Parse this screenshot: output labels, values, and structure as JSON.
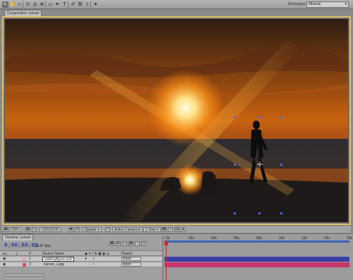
{
  "toolbar": {
    "tools": [
      {
        "icon": "selection-arrow-icon",
        "glyph": "↖",
        "active": true
      },
      {
        "icon": "hand-icon",
        "glyph": "✋",
        "active": false
      },
      {
        "icon": "zoom-icon",
        "glyph": "⌕",
        "active": false
      },
      {
        "icon": "rotate-icon",
        "glyph": "↻",
        "active": false
      },
      {
        "icon": "orbit-camera-icon",
        "glyph": "◎",
        "active": false
      },
      {
        "icon": "pan-behind-icon",
        "glyph": "⊕",
        "active": false
      },
      {
        "icon": "mask-icon",
        "glyph": "▭",
        "active": false
      },
      {
        "icon": "pen-icon",
        "glyph": "✒",
        "active": false
      },
      {
        "icon": "type-icon",
        "glyph": "T",
        "active": false
      },
      {
        "icon": "brush-icon",
        "glyph": "✐",
        "active": false
      },
      {
        "icon": "clone-stamp-icon",
        "glyph": "⌘",
        "active": false
      },
      {
        "icon": "eraser-icon",
        "glyph": "◊",
        "active": false
      },
      {
        "icon": "puppet-pin-icon",
        "glyph": "✦",
        "active": false
      }
    ],
    "workspace_label": "Workspace",
    "workspace_value": "Minimal"
  },
  "composition": {
    "tab_label": "Composition: sunset"
  },
  "viewer_bar": {
    "magnification": "50%",
    "timecode": "0;00;00;00",
    "resolution": "Quarter",
    "camera": "Active Camera",
    "views": "1 View"
  },
  "timeline": {
    "tab_label": "Timeline: sunset",
    "current_time": "0;00;00;01",
    "fps": "(29.97 fps)",
    "column_source_name": "Source Name",
    "column_parent": "Parent",
    "ruler_ticks": [
      "0s",
      "02s",
      "04s",
      "06s",
      "08s",
      "10s",
      "12s",
      "14s",
      "16s"
    ],
    "layers": [
      {
        "num": "1",
        "name": "walkingfigure.psd",
        "parent": "None",
        "selected": true,
        "color": "#e5a0c8",
        "track_color": "#3b3ea6"
      },
      {
        "num": "2",
        "name": "sunset_1.jpg",
        "parent": "None",
        "selected": false,
        "color": "#d94f4f",
        "track_color": "#c8346e"
      }
    ]
  },
  "colors": {
    "accent_frame": "#e7c06a",
    "timecode_blue": "#2b3fa8",
    "cti_red": "#dd2222",
    "work_area_blue": "#3d63b8"
  }
}
